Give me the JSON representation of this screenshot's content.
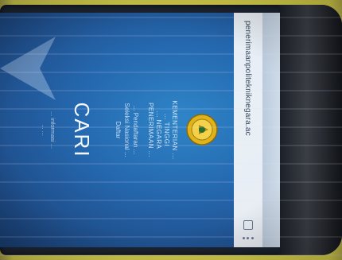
{
  "browser": {
    "url": "penerimaanpolitekniknegara.ac",
    "tab_icon": "tab-count-icon",
    "menu_icon": "overflow-menu-icon"
  },
  "page": {
    "org_lines": [
      "KEMENTERIAN ...",
      "... TINGGI",
      "... NEGARA",
      "PENERIMAAN ..."
    ],
    "sub_lines": [
      "... Pendaftaran ...",
      "Seleksi Nasional ...",
      "Daftar"
    ],
    "search_label": "CARI",
    "foot_lines": [
      "... informasi ...",
      "... ..."
    ]
  },
  "colors": {
    "screen_blue": "#2569b0",
    "emblem_gold": "#e0b21c",
    "photo_background": "#d8d03a"
  }
}
